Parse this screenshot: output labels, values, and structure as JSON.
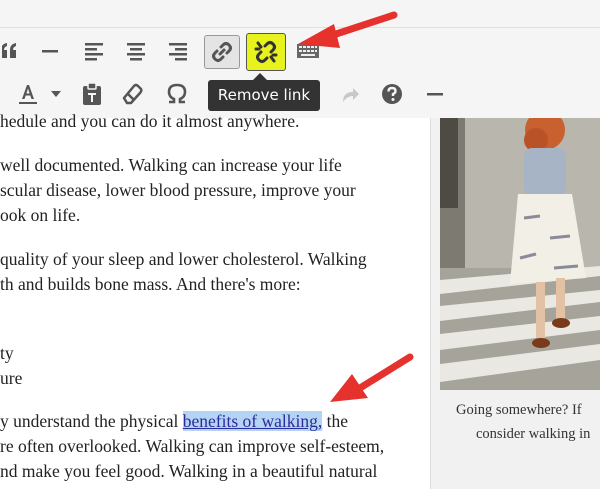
{
  "toolbar": {
    "tooltip": "Remove link",
    "highlight_color": "#e8f21c"
  },
  "editor": {
    "lines": [
      "hedule and you can do it almost anywhere.",
      "well documented. Walking can increase your life",
      "scular disease, lower blood pressure, improve your",
      "ook on life.",
      "quality of your sleep and lower cholesterol. Walking",
      "th and builds bone mass. And there's more:",
      "ty",
      "ure",
      "y understand the physical ",
      "benefits of walking,",
      " the",
      "re often overlooked. Walking can improve self-esteem,",
      "nd make you feel good. Walking in a beautiful natural"
    ],
    "link_color": "#2e2a9c"
  },
  "sidebar": {
    "caption_line1": "Going somewhere? If",
    "caption_line2": "consider walking in"
  },
  "annotation_color": "#e5322d"
}
